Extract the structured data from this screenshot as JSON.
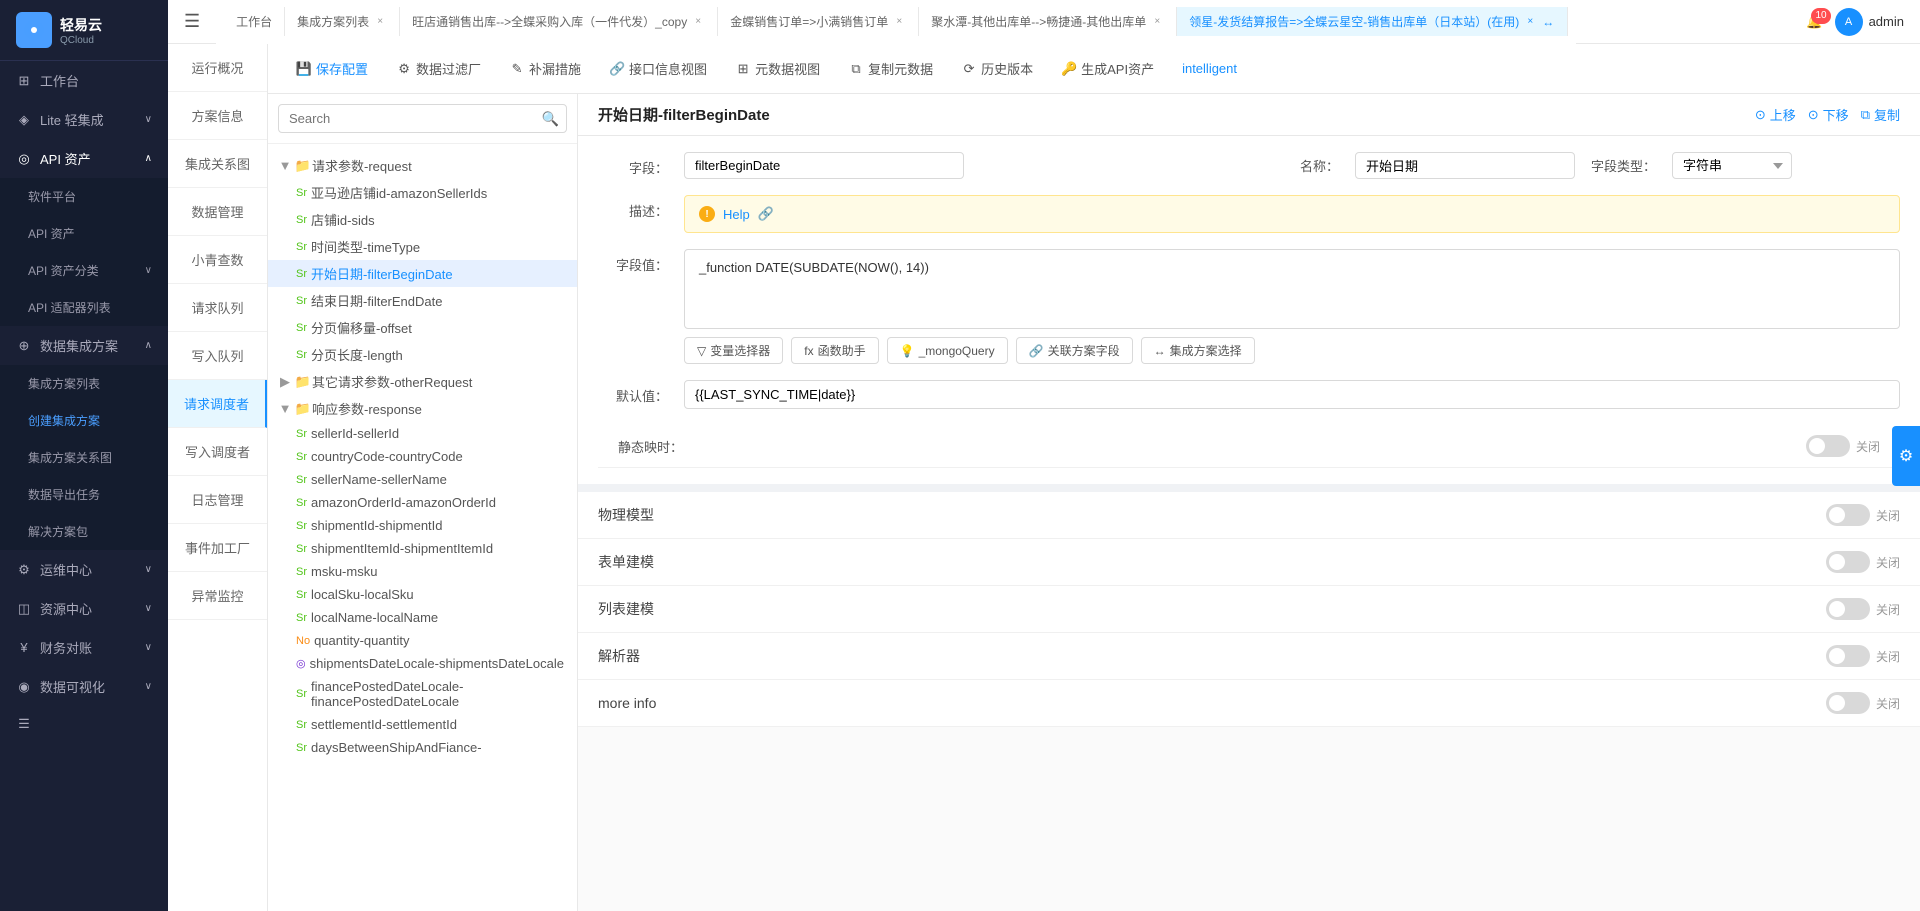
{
  "app": {
    "logo_text": "轻易云",
    "logo_sub": "QCloud",
    "notification_count": "10",
    "user_name": "admin"
  },
  "sidebar": {
    "items": [
      {
        "id": "workspace",
        "label": "工作台",
        "icon": "⊞",
        "active": false
      },
      {
        "id": "lite",
        "label": "Lite 轻集成",
        "icon": "◈",
        "active": false,
        "has_arrow": true
      },
      {
        "id": "api",
        "label": "API 资产",
        "icon": "◎",
        "active": true,
        "expanded": true
      },
      {
        "id": "software-platform",
        "label": "软件平台",
        "sub": true
      },
      {
        "id": "api-assets",
        "label": "API 资产",
        "sub": true
      },
      {
        "id": "api-classify",
        "label": "API 资产分类",
        "sub": true,
        "has_arrow": true
      },
      {
        "id": "api-adapter",
        "label": "API 适配器列表",
        "sub": true
      },
      {
        "id": "data-integration",
        "label": "数据集成方案",
        "icon": "⊕",
        "active": false,
        "expanded": true
      },
      {
        "id": "solution-list",
        "label": "集成方案列表",
        "sub": true
      },
      {
        "id": "create-solution",
        "label": "创建集成方案",
        "sub": true,
        "active": true
      },
      {
        "id": "solution-relation",
        "label": "集成方案关系图",
        "sub": true
      },
      {
        "id": "data-export",
        "label": "数据导出任务",
        "sub": true
      },
      {
        "id": "solution-pack",
        "label": "解决方案包",
        "sub": true
      },
      {
        "id": "ops-center",
        "label": "运维中心",
        "icon": "⚙",
        "has_arrow": true
      },
      {
        "id": "resource-center",
        "label": "资源中心",
        "icon": "◫",
        "has_arrow": true
      },
      {
        "id": "finance",
        "label": "财务对账",
        "icon": "¥",
        "has_arrow": true
      },
      {
        "id": "data-vis",
        "label": "数据可视化",
        "icon": "◉",
        "has_arrow": true
      }
    ]
  },
  "tabs": [
    {
      "id": "workspace",
      "label": "工作台",
      "closable": false
    },
    {
      "id": "solution-list",
      "label": "集成方案列表",
      "closable": true
    },
    {
      "id": "taobao-copy",
      "label": "旺店通销售出库-->全蝶采购入库（一件代发）_copy",
      "closable": true
    },
    {
      "id": "jindie",
      "label": "金蝶销售订单=>小满销售订单",
      "closable": true
    },
    {
      "id": "jushui",
      "label": "聚水潭-其他出库单-->畅捷通-其他出库单",
      "closable": true
    },
    {
      "id": "active-tab",
      "label": "领星-发货结算报告=>全蝶云星空-销售出库单（日本站）(在用)",
      "closable": true,
      "active": true
    },
    {
      "id": "more",
      "label": "···"
    }
  ],
  "left_nav": [
    {
      "id": "overview",
      "label": "运行概况"
    },
    {
      "id": "solution-info",
      "label": "方案信息"
    },
    {
      "id": "relation-map",
      "label": "集成关系图"
    },
    {
      "id": "data-mgmt",
      "label": "数据管理"
    },
    {
      "id": "xiao-qing",
      "label": "小青查数"
    },
    {
      "id": "request-queue",
      "label": "请求队列"
    },
    {
      "id": "write-queue",
      "label": "写入队列"
    },
    {
      "id": "request-debug",
      "label": "请求调度者",
      "active": true
    },
    {
      "id": "write-debug",
      "label": "写入调度者"
    },
    {
      "id": "log-mgmt",
      "label": "日志管理"
    },
    {
      "id": "event-factory",
      "label": "事件加工厂"
    },
    {
      "id": "exception-monitor",
      "label": "异常监控"
    }
  ],
  "toolbar": {
    "save_label": "保存配置",
    "filter_label": "数据过滤厂",
    "supplement_label": "补漏措施",
    "interface_label": "接口信息视图",
    "meta_label": "元数据视图",
    "copy_label": "复制元数据",
    "history_label": "历史版本",
    "api_label": "生成API资产",
    "intelligent_label": "intelligent"
  },
  "search": {
    "placeholder": "Search"
  },
  "tree": {
    "items": [
      {
        "id": "request-params",
        "label": "请求参数-request",
        "type": "folder",
        "indent": 0,
        "expanded": true
      },
      {
        "id": "amazon-seller-ids",
        "label": "亚马逊店铺id-amazonSellerIds",
        "type": "str",
        "type_label": "Sr",
        "indent": 1
      },
      {
        "id": "sids",
        "label": "店铺id-sids",
        "type": "str",
        "type_label": "Sr",
        "indent": 1
      },
      {
        "id": "time-type",
        "label": "时间类型-timeType",
        "type": "str",
        "type_label": "Sr",
        "indent": 1
      },
      {
        "id": "filter-begin-date",
        "label": "开始日期-filterBeginDate",
        "type": "str",
        "type_label": "Sr",
        "indent": 1,
        "selected": true
      },
      {
        "id": "filter-end-date",
        "label": "结束日期-filterEndDate",
        "type": "str",
        "type_label": "Sr",
        "indent": 1
      },
      {
        "id": "offset",
        "label": "分页偏移量-offset",
        "type": "str",
        "type_label": "Sr",
        "indent": 1
      },
      {
        "id": "length",
        "label": "分页长度-length",
        "type": "str",
        "type_label": "Sr",
        "indent": 1
      },
      {
        "id": "other-request",
        "label": "其它请求参数-otherRequest",
        "type": "folder",
        "indent": 0,
        "expanded": false
      },
      {
        "id": "response-params",
        "label": "响应参数-response",
        "type": "folder",
        "indent": 0,
        "expanded": true
      },
      {
        "id": "seller-id",
        "label": "sellerId-sellerId",
        "type": "str",
        "type_label": "Sr",
        "indent": 1
      },
      {
        "id": "country-code",
        "label": "countryCode-countryCode",
        "type": "str",
        "type_label": "Sr",
        "indent": 1
      },
      {
        "id": "seller-name",
        "label": "sellerName-sellerName",
        "type": "str",
        "type_label": "Sr",
        "indent": 1
      },
      {
        "id": "amazon-order-id",
        "label": "amazonOrderId-amazonOrderId",
        "type": "str",
        "type_label": "Sr",
        "indent": 1
      },
      {
        "id": "shipment-id",
        "label": "shipmentId-shipmentId",
        "type": "str",
        "type_label": "Sr",
        "indent": 1
      },
      {
        "id": "shipment-item-id",
        "label": "shipmentItemId-shipmentItemId",
        "type": "str",
        "type_label": "Sr",
        "indent": 1
      },
      {
        "id": "msku",
        "label": "msku-msku",
        "type": "str",
        "type_label": "Sr",
        "indent": 1
      },
      {
        "id": "local-sku",
        "label": "localSku-localSku",
        "type": "str",
        "type_label": "Sr",
        "indent": 1
      },
      {
        "id": "local-name",
        "label": "localName-localName",
        "type": "str",
        "type_label": "Sr",
        "indent": 1
      },
      {
        "id": "quantity",
        "label": "quantity-quantity",
        "type": "no",
        "type_label": "No",
        "indent": 1
      },
      {
        "id": "shipments-date-locale",
        "label": "shipmentsDateLocale-shipmentsDateLocale",
        "type": "obj",
        "type_label": "◎",
        "indent": 1
      },
      {
        "id": "finance-posted-date",
        "label": "financePostedDateLocale-financePostedDateLocale",
        "type": "str",
        "type_label": "Sr",
        "indent": 1
      },
      {
        "id": "settlement-id",
        "label": "settlementId-settlementId",
        "type": "str",
        "type_label": "Sr",
        "indent": 1
      },
      {
        "id": "days-between",
        "label": "daysBetweenShipAndFiance-",
        "type": "str",
        "type_label": "Sr",
        "indent": 1
      }
    ]
  },
  "detail": {
    "title": "开始日期-filterBeginDate",
    "actions": {
      "up": "上移",
      "down": "下移",
      "copy": "复制"
    },
    "field_label": "字段：",
    "field_value": "filterBeginDate",
    "name_label": "名称：",
    "name_value": "开始日期",
    "type_label": "字段类型：",
    "type_value": "字符串",
    "desc_label": "描述：",
    "desc_help": "Help",
    "value_label": "字段值：",
    "value_content": "_function DATE(SUBDATE(NOW(), 14))",
    "value_actions": {
      "variable": "变量选择器",
      "function": "函数助手",
      "mongo": "_mongoQuery",
      "related_field": "关联方案字段",
      "solution_select": "集成方案选择"
    },
    "default_label": "默认值：",
    "default_value": "{{LAST_SYNC_TIME|date}}",
    "static_map_label": "静态映时：",
    "physical_model_label": "物理模型",
    "form_build_label": "表单建模",
    "list_build_label": "列表建模",
    "parser_label": "解析器",
    "more_info_label": "more info"
  }
}
